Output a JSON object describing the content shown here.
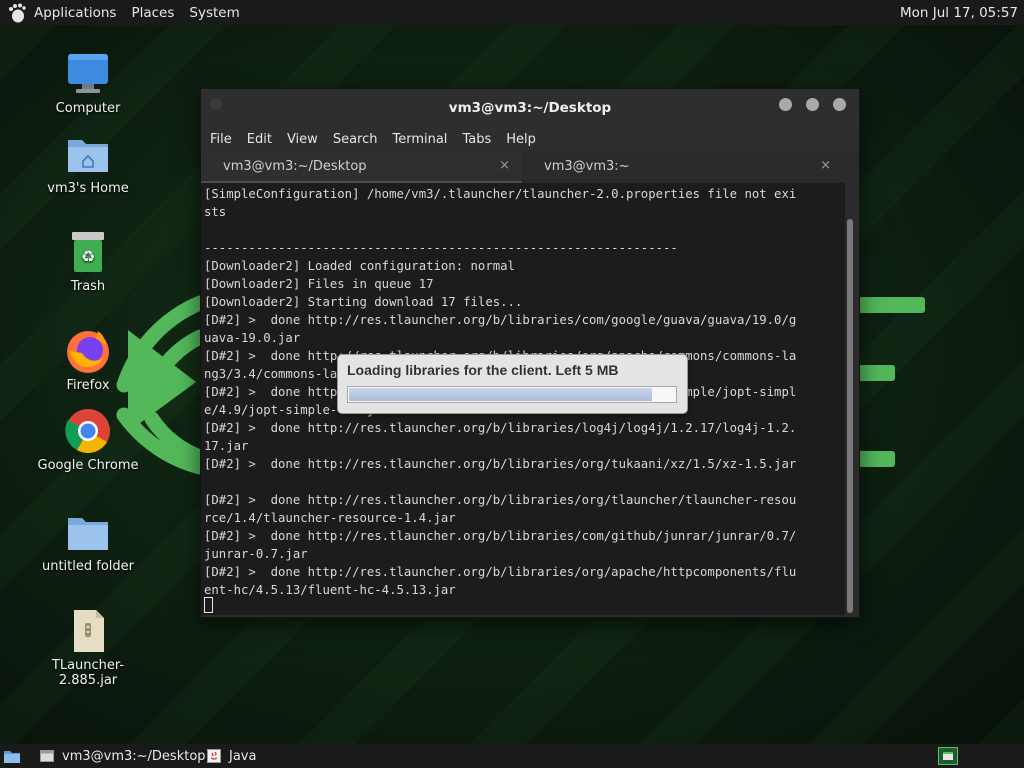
{
  "top_panel": {
    "menus": [
      "Applications",
      "Places",
      "System"
    ],
    "clock": "Mon Jul 17, 05:57"
  },
  "desktop": {
    "icons": [
      {
        "label": "Computer",
        "icon": "computer-icon"
      },
      {
        "label": "vm3's Home",
        "icon": "home-folder-icon"
      },
      {
        "label": "Trash",
        "icon": "trash-icon"
      },
      {
        "label": "Firefox",
        "icon": "firefox-icon"
      },
      {
        "label": "Google Chrome",
        "icon": "chrome-icon"
      },
      {
        "label": "untitled folder",
        "icon": "folder-icon"
      },
      {
        "label": "TLauncher-2.885.jar",
        "icon": "jar-file-icon"
      }
    ]
  },
  "terminal": {
    "title": "vm3@vm3:~/Desktop",
    "menu": [
      "File",
      "Edit",
      "View",
      "Search",
      "Terminal",
      "Tabs",
      "Help"
    ],
    "tabs": [
      {
        "label": "vm3@vm3:~/Desktop",
        "close": "×"
      },
      {
        "label": "vm3@vm3:~",
        "close": "×"
      }
    ],
    "lines": [
      "[SimpleConfiguration] /home/vm3/.tlauncher/tlauncher-2.0.properties file not exi",
      "sts",
      "",
      "----------------------------------------------------------------",
      "[Downloader2] Loaded configuration: normal",
      "[Downloader2] Files in queue 17",
      "[Downloader2] Starting download 17 files...",
      "[D#2] >  done http://res.tlauncher.org/b/libraries/com/google/guava/guava/19.0/g",
      "uava-19.0.jar",
      "[D#2] >  done http://res.tlauncher.org/b/libraries/org/apache/commons/commons-la",
      "ng3/3.4/commons-lang3-3.4.jar",
      "[D#2] >  done http://res.tlauncher.org/b/libraries/net/sf/jopt-simple/jopt-simpl",
      "e/4.9/jopt-simple-4.9.jar",
      "[D#2] >  done http://res.tlauncher.org/b/libraries/log4j/log4j/1.2.17/log4j-1.2.",
      "17.jar",
      "[D#2] >  done http://res.tlauncher.org/b/libraries/org/tukaani/xz/1.5/xz-1.5.jar",
      "",
      "[D#2] >  done http://res.tlauncher.org/b/libraries/org/tlauncher/tlauncher-resou",
      "rce/1.4/tlauncher-resource-1.4.jar",
      "[D#2] >  done http://res.tlauncher.org/b/libraries/com/github/junrar/junrar/0.7/",
      "junrar-0.7.jar",
      "[D#2] >  done http://res.tlauncher.org/b/libraries/org/apache/httpcomponents/flu",
      "ent-hc/4.5.13/fluent-hc-4.5.13.jar"
    ]
  },
  "popup": {
    "message": "Loading libraries for the client. Left 5 MB",
    "progress": 0.96
  },
  "taskbar": {
    "items": [
      {
        "label": "vm3@vm3:~/Desktop",
        "icon": "terminal-icon"
      },
      {
        "label": "Java",
        "icon": "java-icon"
      }
    ]
  },
  "colors": {
    "accent_green": "#4caf50",
    "panel": "#1a1a1a",
    "terminal_bg": "#1c1c1c"
  }
}
